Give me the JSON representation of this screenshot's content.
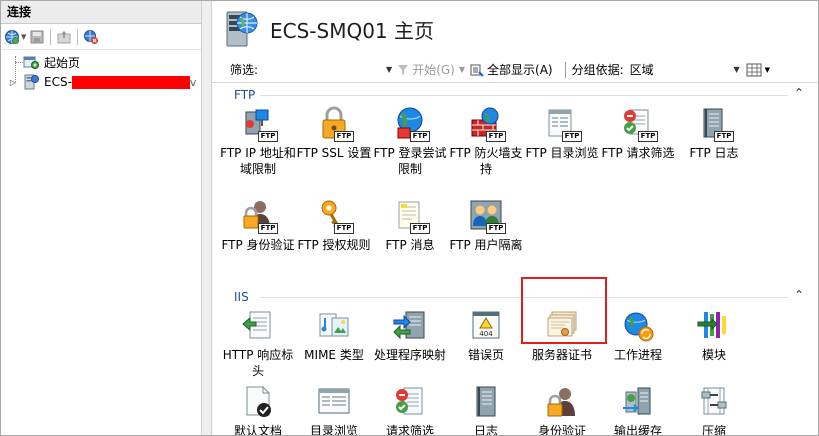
{
  "left": {
    "header": "连接",
    "tree": [
      {
        "label": "起始页"
      },
      {
        "label": "ECS-"
      }
    ]
  },
  "right": {
    "title": "ECS-SMQ01 主页",
    "filter": {
      "label": "筛选:",
      "start": "开始(G)",
      "show_all": "全部显示(A)",
      "group_by": "分组依据:",
      "group_value": "区域"
    },
    "sections": [
      {
        "name": "FTP",
        "items": [
          {
            "label": "FTP IP 地址和域限制",
            "icon": "ftp-ip-restrict-icon"
          },
          {
            "label": "FTP SSL 设置",
            "icon": "ftp-ssl-icon"
          },
          {
            "label": "FTP 登录尝试限制",
            "icon": "ftp-logon-attempt-icon"
          },
          {
            "label": "FTP 防火墙支持",
            "icon": "ftp-firewall-icon"
          },
          {
            "label": "FTP 目录浏览",
            "icon": "ftp-directory-browsing-icon"
          },
          {
            "label": "FTP 请求筛选",
            "icon": "ftp-request-filter-icon"
          },
          {
            "label": "FTP 日志",
            "icon": "ftp-logging-icon"
          },
          {
            "label": "FTP 身份验证",
            "icon": "ftp-authentication-icon"
          },
          {
            "label": "FTP 授权规则",
            "icon": "ftp-authorization-icon"
          },
          {
            "label": "FTP 消息",
            "icon": "ftp-messages-icon"
          },
          {
            "label": "FTP 用户隔离",
            "icon": "ftp-user-isolation-icon"
          }
        ]
      },
      {
        "name": "IIS",
        "items": [
          {
            "label": "HTTP 响应标头",
            "icon": "http-response-headers-icon"
          },
          {
            "label": "MIME 类型",
            "icon": "mime-types-icon"
          },
          {
            "label": "处理程序映射",
            "icon": "handler-mappings-icon"
          },
          {
            "label": "错误页",
            "icon": "error-pages-icon"
          },
          {
            "label": "服务器证书",
            "icon": "server-certificates-icon"
          },
          {
            "label": "工作进程",
            "icon": "worker-processes-icon"
          },
          {
            "label": "模块",
            "icon": "modules-icon"
          },
          {
            "label": "默认文档",
            "icon": "default-document-icon"
          },
          {
            "label": "目录浏览",
            "icon": "directory-browsing-icon"
          },
          {
            "label": "请求筛选",
            "icon": "request-filtering-icon"
          },
          {
            "label": "日志",
            "icon": "logging-icon"
          },
          {
            "label": "身份验证",
            "icon": "authentication-icon"
          },
          {
            "label": "输出缓存",
            "icon": "output-caching-icon"
          },
          {
            "label": "压缩",
            "icon": "compression-icon"
          }
        ]
      }
    ]
  },
  "colors": {
    "section_label": "#1f4e8c",
    "highlight": "#e02020",
    "redaction": "#ff0000"
  }
}
